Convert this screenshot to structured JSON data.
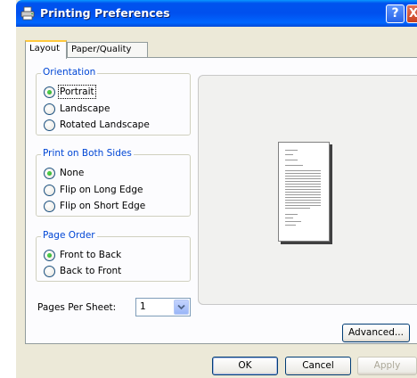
{
  "window": {
    "title": "Printing Preferences",
    "help_glyph": "?",
    "close_glyph": "X"
  },
  "tabs": [
    {
      "label": "Layout",
      "active": true
    },
    {
      "label": "Paper/Quality",
      "active": false
    }
  ],
  "orientation": {
    "legend": "Orientation",
    "options": [
      "Portrait",
      "Landscape",
      "Rotated Landscape"
    ],
    "selected": "Portrait"
  },
  "print_both_sides": {
    "legend": "Print on Both Sides",
    "options": [
      "None",
      "Flip on Long Edge",
      "Flip on Short Edge"
    ],
    "selected": "None"
  },
  "page_order": {
    "legend": "Page Order",
    "options": [
      "Front to Back",
      "Back to Front"
    ],
    "selected": "Front to Back"
  },
  "pages_per_sheet": {
    "label": "Pages Per Sheet:",
    "value": "1"
  },
  "buttons": {
    "advanced": "Advanced...",
    "ok": "OK",
    "cancel": "Cancel",
    "apply": "Apply"
  },
  "icons": {
    "title": "printer-icon",
    "dropdown": "chevron-down-icon"
  },
  "colors": {
    "titlebar": "#0054e3",
    "group_legend": "#0046d5",
    "radio_dot": "#21a121"
  }
}
